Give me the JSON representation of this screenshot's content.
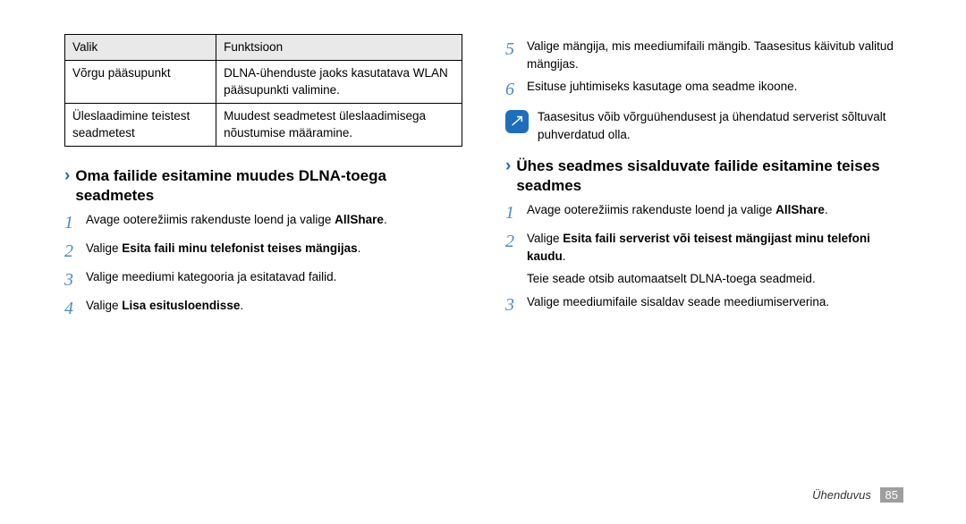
{
  "table": {
    "head": [
      "Valik",
      "Funktsioon"
    ],
    "rows": [
      [
        "Võrgu pääsupunkt",
        "DLNA-ühenduste jaoks kasutatava WLAN pääsupunkti valimine."
      ],
      [
        "Üleslaadimine teistest seadmetest",
        "Muudest seadmetest üleslaadimisega nõustumise määramine."
      ]
    ]
  },
  "left_heading": "Oma failide esitamine muudes DLNA-toega seadmetes",
  "left_steps": [
    {
      "n": "1",
      "t": "Avage ooterežiimis rakenduste loend ja valige <b>AllShare</b>."
    },
    {
      "n": "2",
      "t": "Valige <b>Esita faili minu telefonist teises mängijas</b>."
    },
    {
      "n": "3",
      "t": "Valige meediumi kategooria ja esitatavad failid."
    },
    {
      "n": "4",
      "t": "Valige <b>Lisa esitusloendisse</b>."
    }
  ],
  "right_steps_a": [
    {
      "n": "5",
      "t": "Valige mängija, mis meediumifaili mängib. Taasesitus käivitub valitud mängijas."
    },
    {
      "n": "6",
      "t": "Esituse juhtimiseks kasutage oma seadme ikoone."
    }
  ],
  "note_text": "Taasesitus võib võrguühendusest ja ühendatud serverist sõltuvalt puhverdatud olla.",
  "right_heading": "Ühes seadmes sisalduvate failide esitamine teises seadmes",
  "right_steps_b": [
    {
      "n": "1",
      "t": "Avage ooterežiimis rakenduste loend ja valige <b>AllShare</b>."
    },
    {
      "n": "2",
      "t": "Valige <b>Esita faili serverist või teisest mängijast minu telefoni kaudu</b>."
    }
  ],
  "sub_text": "Teie seade otsib automaatselt DLNA-toega seadmeid.",
  "right_steps_c": [
    {
      "n": "3",
      "t": "Valige meediumifaile sisaldav seade meediumiserverina."
    }
  ],
  "footer_section": "Ühenduvus",
  "footer_page": "85"
}
